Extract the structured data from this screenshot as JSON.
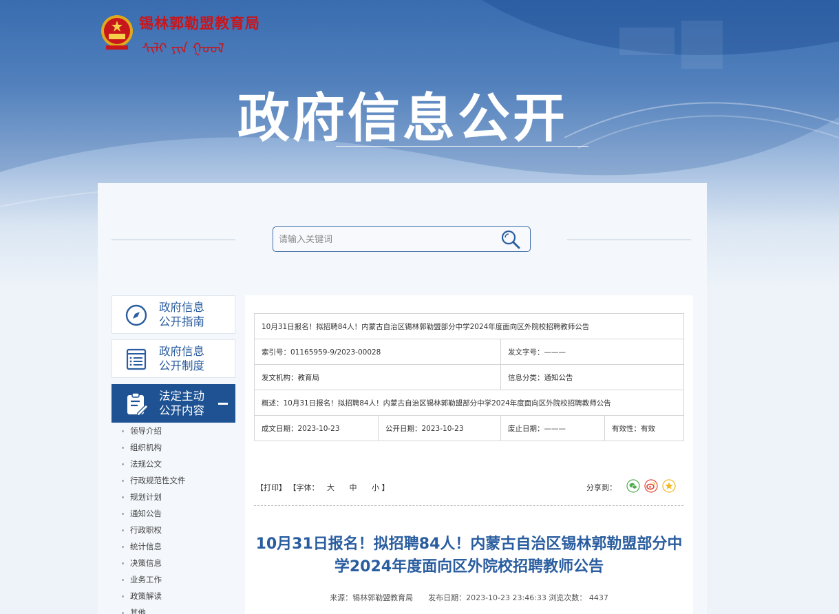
{
  "header": {
    "site_name": "锡林郭勒盟教育局",
    "site_name_script": "ᠰᠢᠯᠢ ᠶᠢᠨ ᠭᠣᠣᠯ",
    "hero_title": "政府信息公开"
  },
  "search": {
    "placeholder": "请输入关键词"
  },
  "sidebar": {
    "cards": [
      {
        "label": "政府信息公开指南",
        "line1": "政府信息",
        "line2": "公开指南"
      },
      {
        "label": "政府信息公开制度",
        "line1": "政府信息",
        "line2": "公开制度"
      },
      {
        "label": "法定主动公开内容",
        "line1": "法定主动",
        "line2": "公开内容"
      }
    ],
    "items": [
      "领导介绍",
      "组织机构",
      "法规公文",
      "行政规范性文件",
      "规划计划",
      "通知公告",
      "行政职权",
      "统计信息",
      "决策信息",
      "业务工作",
      "政策解读",
      "其他"
    ]
  },
  "meta": {
    "title_row": "10月31日报名！拟招聘84人！内蒙古自治区锡林郭勒盟部分中学2024年度面向区外院校招聘教师公告",
    "index_no": "索引号：01165959-9/2023-00028",
    "doc_no": "发文字号：———",
    "issuer": "发文机构：教育局",
    "category": "信息分类：通知公告",
    "summary": "概述：10月31日报名！拟招聘84人！内蒙古自治区锡林郭勒盟部分中学2024年度面向区外院校招聘教师公告",
    "created": "成文日期：2023-10-23",
    "published": "公开日期：2023-10-23",
    "expiry": "废止日期：———",
    "validity": "有效性：有效"
  },
  "toolbar": {
    "print": "【打印】",
    "font_label": "【字体：",
    "font_large": "大",
    "font_medium": "中",
    "font_small": "小",
    "font_close": "】",
    "share_label": "分享到："
  },
  "article": {
    "title": "10月31日报名！拟招聘84人！内蒙古自治区锡林郭勒盟部分中学2024年度面向区外院校招聘教师公告",
    "meta_line": "来源：锡林郭勒盟教育局　　发布日期：2023-10-23 23:46:33 浏览次数：  4437"
  },
  "colors": {
    "brand_blue": "#1e5293",
    "title_blue": "#2a5d9f",
    "emblem_red": "#c8161d",
    "wechat_green": "#4cae4c",
    "weibo_red": "#e6432f",
    "qzone_yellow": "#f2b61f"
  }
}
